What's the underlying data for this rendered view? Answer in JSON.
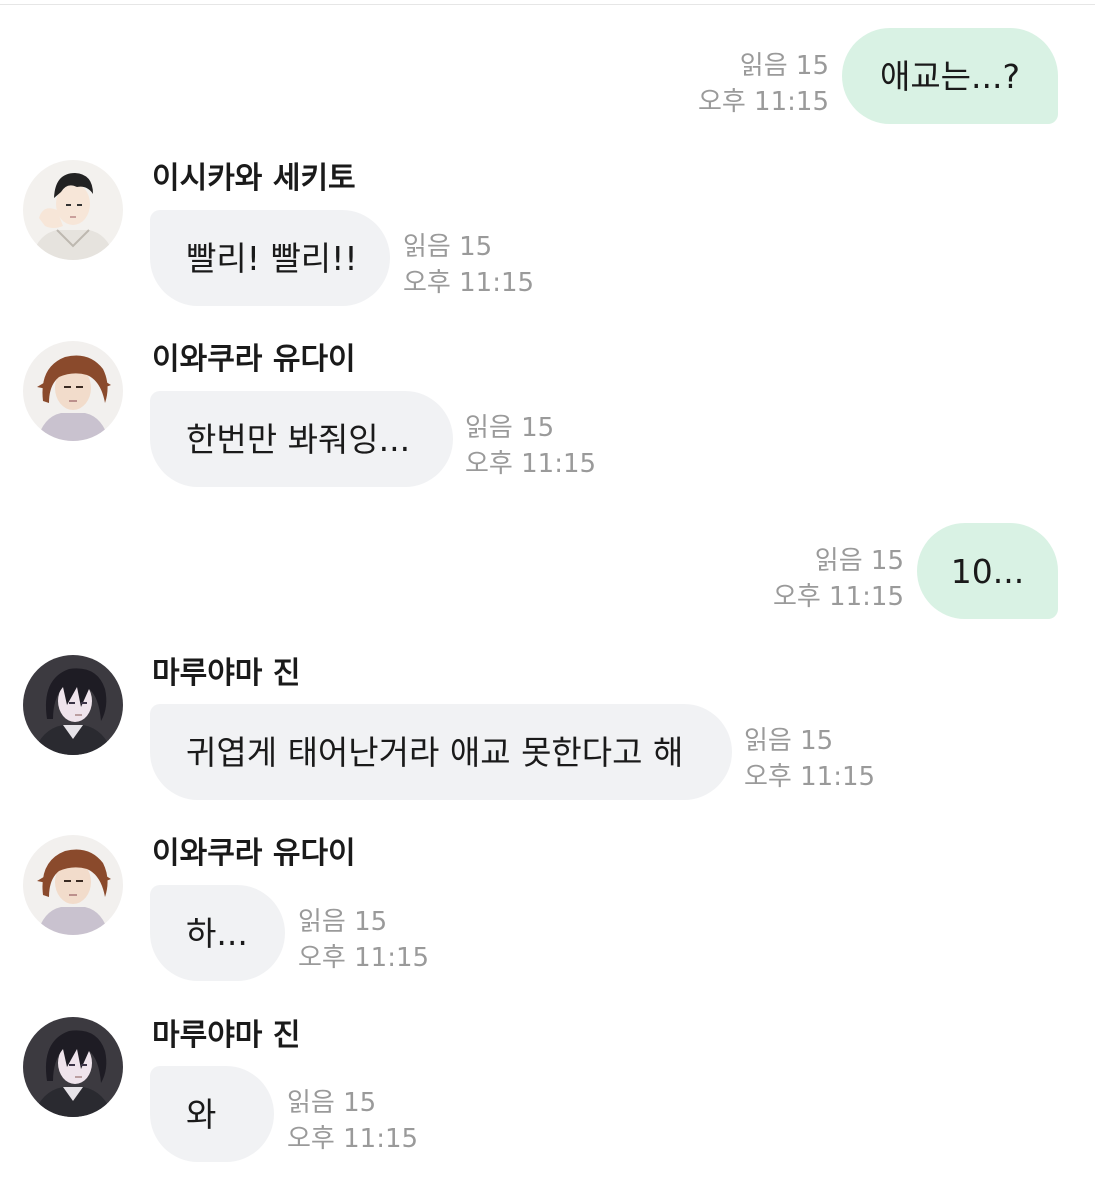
{
  "messages": [
    {
      "direction": "out",
      "text": "애교는...?",
      "read": "읽음 15",
      "time": "오후 11:15"
    },
    {
      "direction": "in",
      "sender": "이시카와 세키토",
      "avatar": "avatar-ishikawa",
      "text": "빨리! 빨리!!",
      "read": "읽음 15",
      "time": "오후 11:15"
    },
    {
      "direction": "in",
      "sender": "이와쿠라 유다이",
      "avatar": "avatar-iwakura",
      "text": "한번만 봐줘잉...",
      "read": "읽음 15",
      "time": "오후 11:15"
    },
    {
      "direction": "out",
      "text": "10...",
      "read": "읽음 15",
      "time": "오후 11:15"
    },
    {
      "direction": "in",
      "sender": "마루야마 진",
      "avatar": "avatar-maruyama",
      "text": "귀엽게 태어난거라 애교 못한다고 해",
      "read": "읽음 15",
      "time": "오후 11:15"
    },
    {
      "direction": "in",
      "sender": "이와쿠라 유다이",
      "avatar": "avatar-iwakura",
      "text": "하...",
      "read": "읽음 15",
      "time": "오후 11:15"
    },
    {
      "direction": "in",
      "sender": "마루야마 진",
      "avatar": "avatar-maruyama",
      "text": "와",
      "read": "읽음 15",
      "time": "오후 11:15"
    }
  ],
  "colors": {
    "outgoing_bubble": "#d9f2e4",
    "incoming_bubble": "#f1f2f4",
    "meta_text": "#9a9a9a"
  }
}
